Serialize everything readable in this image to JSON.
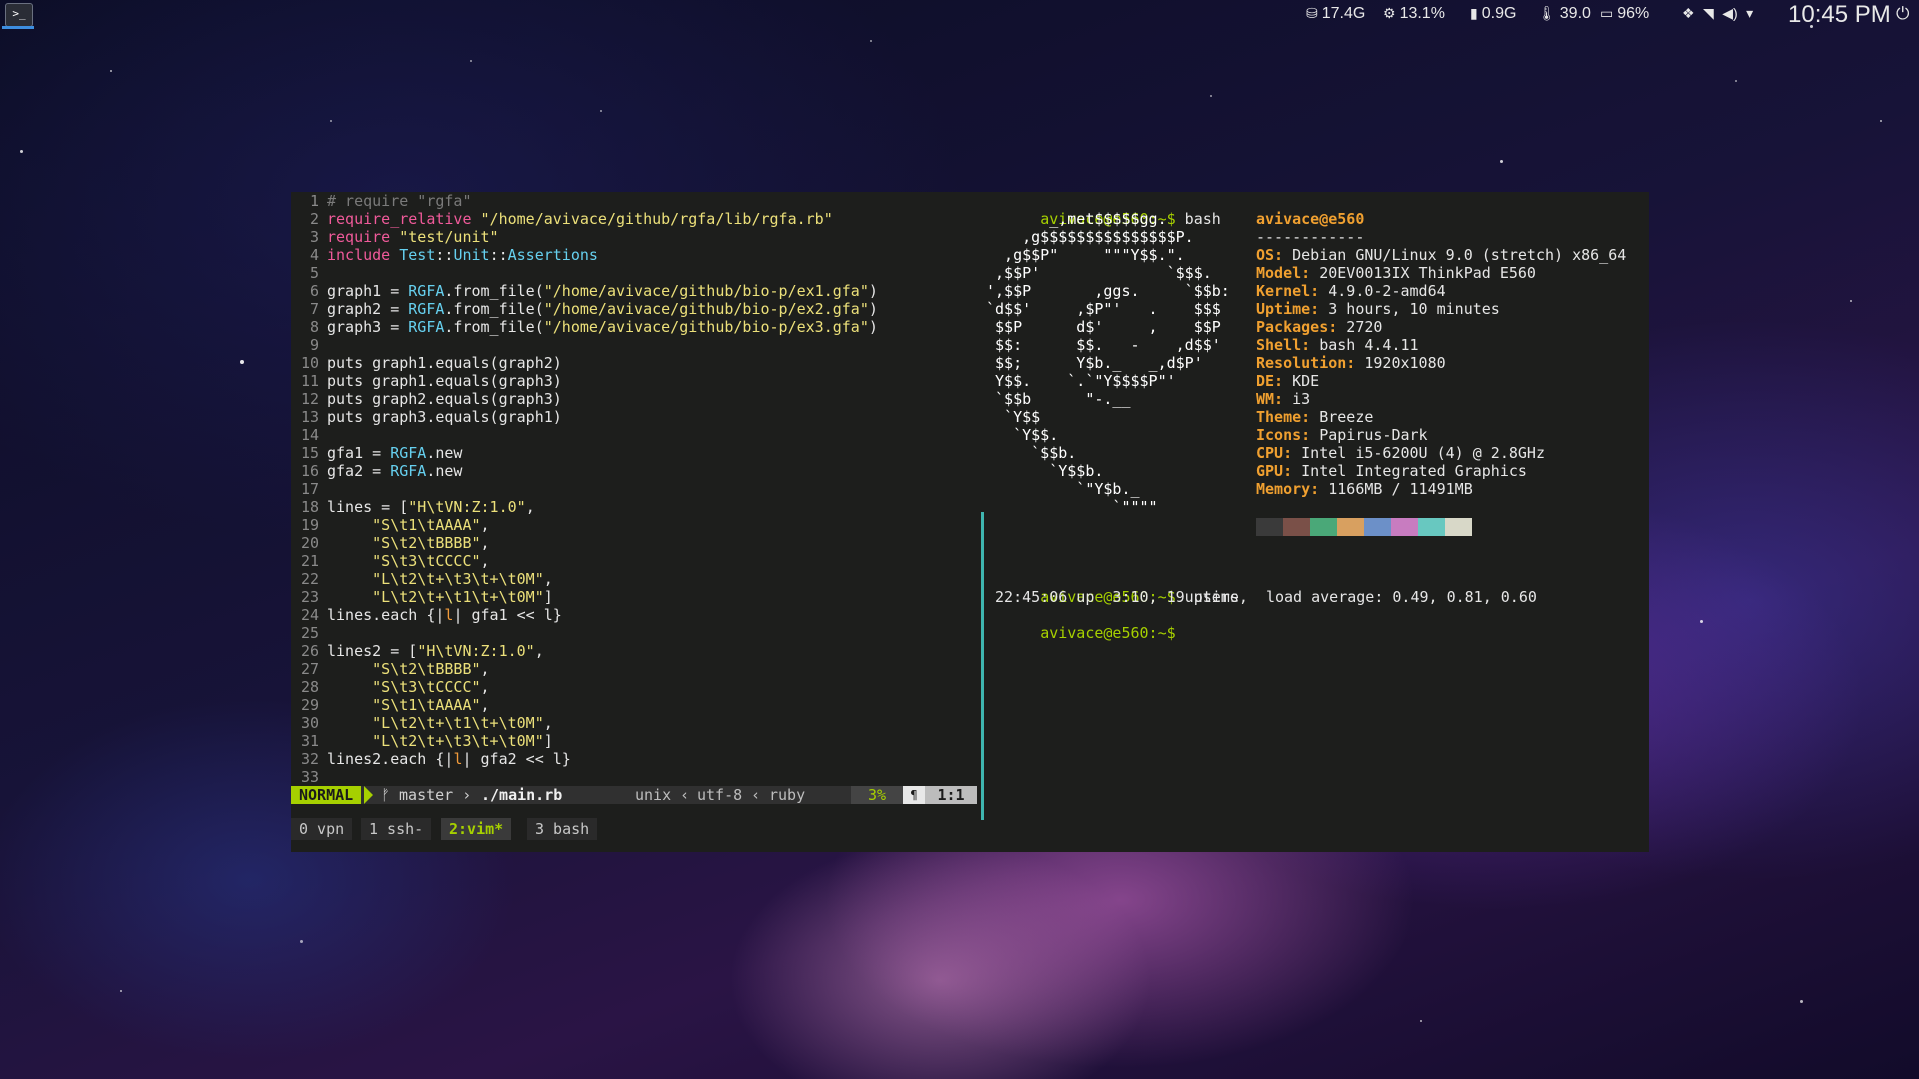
{
  "topbar": {
    "disk": "17.4G",
    "cpu": "13.1%",
    "ram": "0.9G",
    "temp": "39.0",
    "battery": "96%",
    "clock": "10:45 PM"
  },
  "vim": {
    "lines": [
      {
        "n": "1",
        "parts": [
          [
            "c-comment",
            "# require \"rgfa\""
          ]
        ]
      },
      {
        "n": "2",
        "parts": [
          [
            "c-keyword",
            "require_relative "
          ],
          [
            "c-string",
            "\"/home/avivace/github/rgfa/lib/rgfa.rb\""
          ]
        ]
      },
      {
        "n": "3",
        "parts": [
          [
            "c-keyword",
            "require "
          ],
          [
            "c-string",
            "\"test/unit\""
          ]
        ]
      },
      {
        "n": "4",
        "parts": [
          [
            "c-keyword",
            "include "
          ],
          [
            "c-const",
            "Test"
          ],
          [
            "c-text",
            "::"
          ],
          [
            "c-const",
            "Unit"
          ],
          [
            "c-text",
            "::"
          ],
          [
            "c-const",
            "Assertions"
          ]
        ]
      },
      {
        "n": "5",
        "parts": []
      },
      {
        "n": "6",
        "parts": [
          [
            "c-text",
            "graph1 = "
          ],
          [
            "c-const",
            "RGFA"
          ],
          [
            "c-text",
            ".from_file("
          ],
          [
            "c-string",
            "\"/home/avivace/github/bio-p/ex1.gfa\""
          ],
          [
            "c-text",
            ")"
          ]
        ]
      },
      {
        "n": "7",
        "parts": [
          [
            "c-text",
            "graph2 = "
          ],
          [
            "c-const",
            "RGFA"
          ],
          [
            "c-text",
            ".from_file("
          ],
          [
            "c-string",
            "\"/home/avivace/github/bio-p/ex2.gfa\""
          ],
          [
            "c-text",
            ")"
          ]
        ]
      },
      {
        "n": "8",
        "parts": [
          [
            "c-text",
            "graph3 = "
          ],
          [
            "c-const",
            "RGFA"
          ],
          [
            "c-text",
            ".from_file("
          ],
          [
            "c-string",
            "\"/home/avivace/github/bio-p/ex3.gfa\""
          ],
          [
            "c-text",
            ")"
          ]
        ]
      },
      {
        "n": "9",
        "parts": []
      },
      {
        "n": "10",
        "parts": [
          [
            "c-text",
            "puts graph1.equals(graph2)"
          ]
        ]
      },
      {
        "n": "11",
        "parts": [
          [
            "c-text",
            "puts graph1.equals(graph3)"
          ]
        ]
      },
      {
        "n": "12",
        "parts": [
          [
            "c-text",
            "puts graph2.equals(graph3)"
          ]
        ]
      },
      {
        "n": "13",
        "parts": [
          [
            "c-text",
            "puts graph3.equals(graph1)"
          ]
        ]
      },
      {
        "n": "14",
        "parts": []
      },
      {
        "n": "15",
        "parts": [
          [
            "c-text",
            "gfa1 = "
          ],
          [
            "c-const",
            "RGFA"
          ],
          [
            "c-text",
            ".new"
          ]
        ]
      },
      {
        "n": "16",
        "parts": [
          [
            "c-text",
            "gfa2 = "
          ],
          [
            "c-const",
            "RGFA"
          ],
          [
            "c-text",
            ".new"
          ]
        ]
      },
      {
        "n": "17",
        "parts": []
      },
      {
        "n": "18",
        "parts": [
          [
            "c-text",
            "lines = ["
          ],
          [
            "c-string",
            "\"H\\tVN:Z:1.0\""
          ],
          [
            "c-text",
            ","
          ]
        ]
      },
      {
        "n": "19",
        "parts": [
          [
            "c-text",
            "     "
          ],
          [
            "c-string",
            "\"S\\t1\\tAAAA\""
          ],
          [
            "c-text",
            ","
          ]
        ]
      },
      {
        "n": "20",
        "parts": [
          [
            "c-text",
            "     "
          ],
          [
            "c-string",
            "\"S\\t2\\tBBBB\""
          ],
          [
            "c-text",
            ","
          ]
        ]
      },
      {
        "n": "21",
        "parts": [
          [
            "c-text",
            "     "
          ],
          [
            "c-string",
            "\"S\\t3\\tCCCC\""
          ],
          [
            "c-text",
            ","
          ]
        ]
      },
      {
        "n": "22",
        "parts": [
          [
            "c-text",
            "     "
          ],
          [
            "c-string",
            "\"L\\t2\\t+\\t3\\t+\\t0M\""
          ],
          [
            "c-text",
            ","
          ]
        ]
      },
      {
        "n": "23",
        "parts": [
          [
            "c-text",
            "     "
          ],
          [
            "c-string",
            "\"L\\t2\\t+\\t1\\t+\\t0M\""
          ],
          [
            "c-text",
            "]"
          ]
        ]
      },
      {
        "n": "24",
        "parts": [
          [
            "c-text",
            "lines.each {|"
          ],
          [
            "c-pipe",
            "l"
          ],
          [
            "c-text",
            "| gfa1 << l}"
          ]
        ]
      },
      {
        "n": "25",
        "parts": []
      },
      {
        "n": "26",
        "parts": [
          [
            "c-text",
            "lines2 = ["
          ],
          [
            "c-string",
            "\"H\\tVN:Z:1.0\""
          ],
          [
            "c-text",
            ","
          ]
        ]
      },
      {
        "n": "27",
        "parts": [
          [
            "c-text",
            "     "
          ],
          [
            "c-string",
            "\"S\\t2\\tBBBB\""
          ],
          [
            "c-text",
            ","
          ]
        ]
      },
      {
        "n": "28",
        "parts": [
          [
            "c-text",
            "     "
          ],
          [
            "c-string",
            "\"S\\t3\\tCCCC\""
          ],
          [
            "c-text",
            ","
          ]
        ]
      },
      {
        "n": "29",
        "parts": [
          [
            "c-text",
            "     "
          ],
          [
            "c-string",
            "\"S\\t1\\tAAAA\""
          ],
          [
            "c-text",
            ","
          ]
        ]
      },
      {
        "n": "30",
        "parts": [
          [
            "c-text",
            "     "
          ],
          [
            "c-string",
            "\"L\\t2\\t+\\t1\\t+\\t0M\""
          ],
          [
            "c-text",
            ","
          ]
        ]
      },
      {
        "n": "31",
        "parts": [
          [
            "c-text",
            "     "
          ],
          [
            "c-string",
            "\"L\\t2\\t+\\t3\\t+\\t0M\""
          ],
          [
            "c-text",
            "]"
          ]
        ]
      },
      {
        "n": "32",
        "parts": [
          [
            "c-text",
            "lines2.each {|"
          ],
          [
            "c-pipe",
            "l"
          ],
          [
            "c-text",
            "| gfa2 << l}"
          ]
        ]
      },
      {
        "n": "33",
        "parts": []
      }
    ],
    "status": {
      "mode": "NORMAL",
      "branch": "ᚠ master ›",
      "file": "./main.rb",
      "fileformat": "unix ‹",
      "encoding": "utf-8 ‹",
      "filetype": "ruby",
      "percent": "3%",
      "ln_icon": "¶",
      "position": "1:1"
    }
  },
  "shell": {
    "prompt": "avivace@e560:~$",
    "cmd1": " bash",
    "cmd2": " uptime",
    "uptime_output": " 22:45:06 up  3:10, 19 users,  load average: 0.49, 0.81, 0.60",
    "ascii": [
      "       _,met$$$$$gg.",
      "    ,g$$$$$$$$$$$$$$$P.",
      "  ,g$$P\"     \"\"\"Y$$.\".",
      " ,$$P'              `$$$.",
      "',$$P       ,ggs.     `$$b:",
      "`d$$'     ,$P\"'   .    $$$",
      " $$P      d$'     ,    $$P",
      " $$:      $$.   -    ,d$$'",
      " $$;      Y$b._   _,d$P'",
      " Y$$.    `.`\"Y$$$$P\"'",
      " `$$b      \"-.__",
      "  `Y$$",
      "   `Y$$.",
      "     `$$b.",
      "       `Y$$b.",
      "          `\"Y$b._",
      "              `\"\"\"\""
    ],
    "user_host": "avivace@e560",
    "separator": "------------",
    "info": [
      {
        "key": "OS:",
        "val": " Debian GNU/Linux 9.0 (stretch) x86_64"
      },
      {
        "key": "Model:",
        "val": " 20EV0013IX ThinkPad E560"
      },
      {
        "key": "Kernel:",
        "val": " 4.9.0-2-amd64"
      },
      {
        "key": "Uptime:",
        "val": " 3 hours, 10 minutes"
      },
      {
        "key": "Packages:",
        "val": " 2720"
      },
      {
        "key": "Shell:",
        "val": " bash 4.4.11"
      },
      {
        "key": "Resolution:",
        "val": " 1920x1080"
      },
      {
        "key": "DE:",
        "val": " KDE"
      },
      {
        "key": "WM:",
        "val": " i3"
      },
      {
        "key": "Theme:",
        "val": " Breeze"
      },
      {
        "key": "Icons:",
        "val": " Papirus-Dark"
      },
      {
        "key": "CPU:",
        "val": " Intel i5-6200U (4) @ 2.8GHz"
      },
      {
        "key": "GPU:",
        "val": " Intel Integrated Graphics"
      },
      {
        "key": "Memory:",
        "val": " 1166MB / 11491MB"
      }
    ],
    "palette": [
      "#3a3a3a",
      "#7a5048",
      "#4aa878",
      "#d8a060",
      "#6c90c8",
      "#c87cc0",
      "#68c8c0",
      "#d8d8c8"
    ]
  },
  "tmux": {
    "tabs": [
      {
        "label": "0 vpn",
        "active": false
      },
      {
        "label": "1 ssh-",
        "active": false
      },
      {
        "label": "2:vim*",
        "active": true
      },
      {
        "label": "3 bash",
        "active": false
      }
    ]
  }
}
